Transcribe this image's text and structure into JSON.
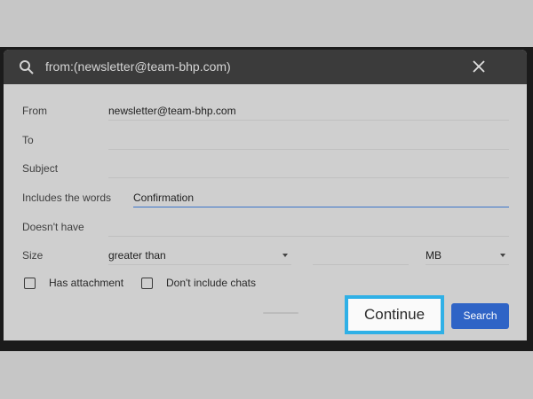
{
  "search": {
    "query": "from:(newsletter@team-bhp.com)",
    "search_icon": "search-icon",
    "close_icon": "close-icon"
  },
  "form": {
    "from": {
      "label": "From",
      "value": "newsletter@team-bhp.com"
    },
    "to": {
      "label": "To",
      "value": ""
    },
    "subject": {
      "label": "Subject",
      "value": ""
    },
    "includes": {
      "label": "Includes the words",
      "value": "Confirmation"
    },
    "doesnt_have": {
      "label": "Doesn't have",
      "value": ""
    },
    "size": {
      "label": "Size",
      "operator": "greater than",
      "amount": "",
      "unit": "MB"
    },
    "has_attachment": {
      "label": "Has attachment",
      "checked": false
    },
    "no_chats": {
      "label": "Don't include chats",
      "checked": false
    }
  },
  "actions": {
    "continue_label": "Continue",
    "search_label": "Search"
  },
  "colors": {
    "accent": "#2f64c6",
    "highlight": "#2fb0e6",
    "dialog_bg": "#cfcfcf",
    "header_bg": "#3b3b3b"
  }
}
